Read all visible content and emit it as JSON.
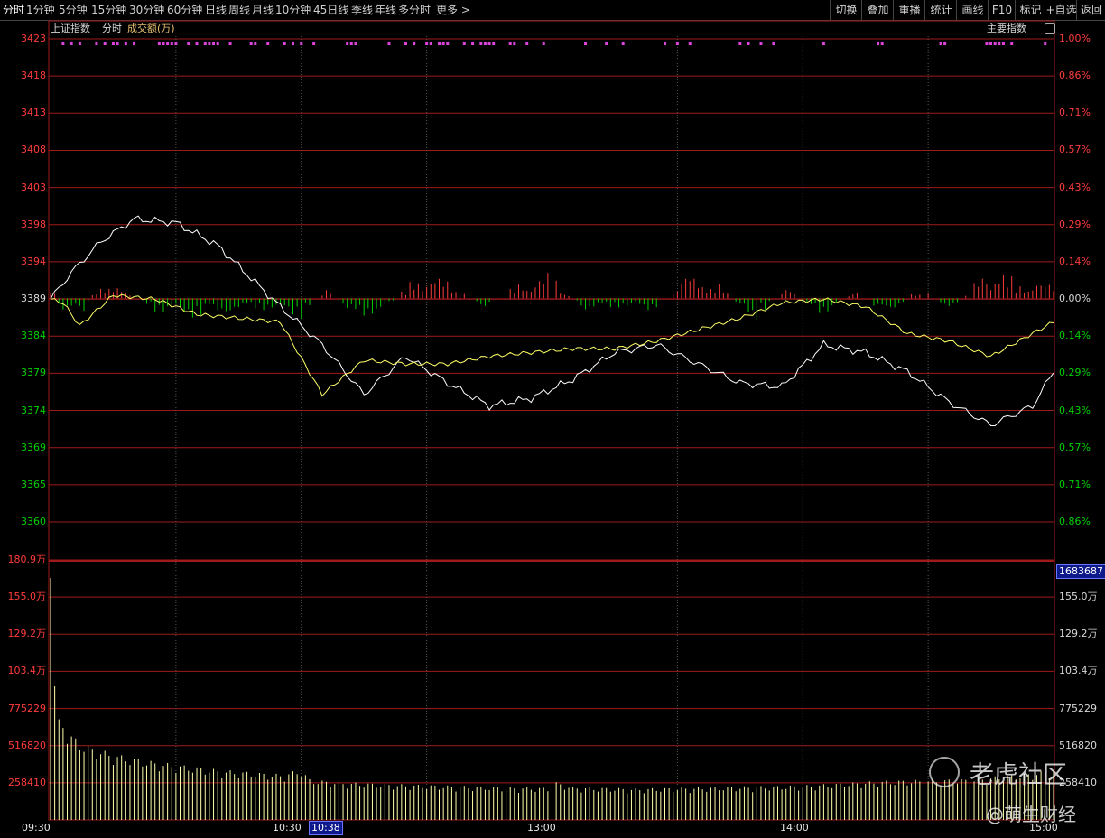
{
  "toolbar": {
    "left_items": [
      "分时",
      "1分钟",
      "5分钟",
      "15分钟",
      "30分钟",
      "60分钟",
      "日线",
      "周线",
      "月线",
      "10分钟",
      "45日线",
      "季线",
      "年线",
      "多分时",
      "更多 >"
    ],
    "right_items": [
      "切换",
      "叠加",
      "重播",
      "统计",
      "画线",
      "F10",
      "标记",
      "+自选",
      "返回"
    ]
  },
  "header": {
    "index_name": "上证指数",
    "mode": "分时",
    "indicator": "成交额(万)",
    "overlay_label": "主要指数"
  },
  "volume_badge": "1683687",
  "colors": {
    "up": "#ff3c3c",
    "down": "#00d200",
    "grid": "#a01a1a",
    "price_line": "#ffffff",
    "avg_line": "#ffff66",
    "vol_bar": "#ffffaa",
    "marker": "#dd44dd"
  },
  "watermark": {
    "brand": "老虎社区",
    "author": "@萌生财经"
  },
  "chart_data": {
    "type": "line",
    "title": "上证指数 分时",
    "x_ticks": [
      "09:30",
      "10:30",
      "13:00",
      "14:00",
      "15:00"
    ],
    "x_highlight": "10:38",
    "price_axis": {
      "labels": [
        "3423",
        "3418",
        "3413",
        "3408",
        "3403",
        "3398",
        "3394",
        "3389",
        "3384",
        "3379",
        "3374",
        "3369",
        "3365",
        "3360"
      ],
      "pct_labels": [
        "1.00%",
        "0.86%",
        "0.71%",
        "0.57%",
        "0.43%",
        "0.29%",
        "0.14%",
        "0.00%",
        "0.14%",
        "0.29%",
        "0.43%",
        "0.57%",
        "0.71%",
        "0.86%"
      ],
      "prev_close": 3389.1,
      "ylim": [
        3359.8,
        3423.1
      ]
    },
    "volume_axis": {
      "labels": [
        "180.9万",
        "155.0万",
        "129.2万",
        "103.4万",
        "775229",
        "516820",
        "258410"
      ],
      "ylim": [
        0,
        1809000
      ]
    },
    "series": [
      {
        "name": "上证指数",
        "color": "#ffffff",
        "t": [
          0,
          5,
          12,
          20,
          30,
          40,
          55,
          65,
          75,
          85,
          95,
          105,
          115,
          125,
          135,
          145,
          155,
          165,
          175,
          185,
          195,
          205,
          215,
          225,
          235,
          240
        ],
        "values": [
          3389.0,
          3392.5,
          3396.5,
          3399.5,
          3399.0,
          3396.0,
          3388.0,
          3383.0,
          3376.5,
          3381.5,
          3378.0,
          3375.0,
          3376.0,
          3378.5,
          3382.0,
          3383.0,
          3380.5,
          3378.0,
          3377.5,
          3383.0,
          3382.0,
          3379.5,
          3375.5,
          3372.5,
          3375.0,
          3379.5
        ]
      },
      {
        "name": "均价",
        "color": "#ffff66",
        "t": [
          0,
          3,
          7,
          15,
          25,
          35,
          45,
          55,
          65,
          75,
          85,
          95,
          105,
          115,
          125,
          135,
          145,
          155,
          165,
          175,
          185,
          195,
          205,
          215,
          225,
          235,
          240
        ],
        "values": [
          3389.0,
          3388.5,
          3385.5,
          3389.5,
          3389.0,
          3387.0,
          3386.5,
          3386.0,
          3376.5,
          3381.0,
          3380.5,
          3380.5,
          3381.5,
          3382.0,
          3382.5,
          3382.5,
          3383.5,
          3385.0,
          3386.5,
          3388.5,
          3389.0,
          3388.0,
          3384.5,
          3383.5,
          3381.5,
          3384.5,
          3386.0
        ]
      }
    ],
    "volume_points": {
      "t": [
        0,
        1,
        2,
        4,
        8,
        15,
        25,
        40,
        55,
        60,
        62,
        65,
        70,
        80,
        100,
        119,
        120,
        121,
        125,
        140,
        160,
        180,
        200,
        220,
        235,
        240
      ],
      "values": [
        1683687,
        930000,
        700000,
        560000,
        480000,
        420000,
        370000,
        320000,
        290000,
        320000,
        260000,
        250000,
        240000,
        230000,
        215000,
        205000,
        380000,
        240000,
        210000,
        200000,
        210000,
        220000,
        250000,
        260000,
        300000,
        320000
      ]
    },
    "buy_sell_bars": {
      "t": [
        0,
        2,
        4,
        6,
        8,
        12,
        18,
        26,
        36,
        44,
        52,
        60,
        66,
        72,
        80,
        88,
        96,
        104,
        112,
        120,
        128,
        136,
        144,
        152,
        160,
        168,
        176,
        184,
        192,
        200,
        208,
        216,
        224,
        232,
        238
      ],
      "values": [
        0.1,
        -0.06,
        -0.11,
        -0.04,
        -0.06,
        0.09,
        0.03,
        -0.07,
        -0.09,
        -0.06,
        -0.05,
        -0.09,
        0.05,
        -0.1,
        -0.06,
        0.12,
        0.08,
        -0.05,
        0.07,
        0.12,
        -0.06,
        -0.04,
        -0.06,
        0.11,
        0.07,
        -0.12,
        0.06,
        -0.1,
        0.05,
        -0.09,
        0.06,
        -0.07,
        0.15,
        0.08,
        0.07
      ]
    }
  }
}
